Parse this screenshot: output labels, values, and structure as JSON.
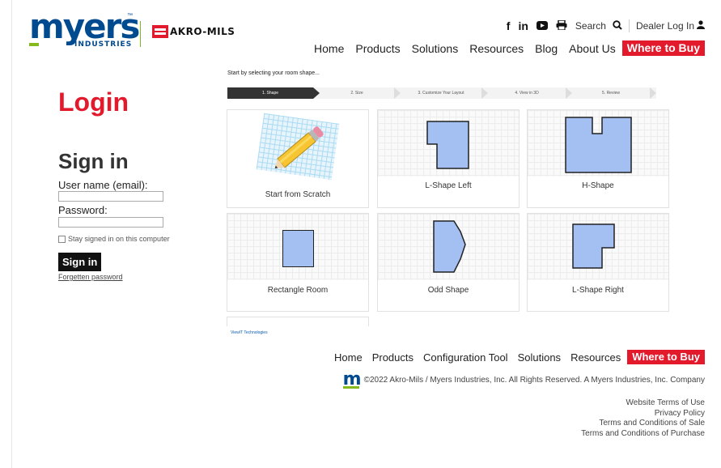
{
  "header": {
    "brand": "myers",
    "brand_sub": "INDUSTRIES",
    "brand_tm": "™",
    "partner_brand": "AKRO-MILS",
    "util": {
      "search_label": "Search",
      "dealer_login_label": "Dealer Log In"
    },
    "nav": [
      "Home",
      "Products",
      "Solutions",
      "Resources",
      "Blog",
      "About Us"
    ],
    "where_to_buy": "Where to Buy"
  },
  "login": {
    "title": "Login",
    "signin_title": "Sign in",
    "username_label": "User name (email):",
    "password_label": "Password:",
    "stay_signed_in": "Stay signed in on this computer",
    "signin_button": "Sign in",
    "forgot_link": "Forgetten password"
  },
  "wizard": {
    "prompt": "Start by selecting your room shape...",
    "steps": [
      "1. Shape",
      "2. Size",
      "3. Customize Your Layout",
      "4. View in 3D",
      "5. Review"
    ],
    "active_step": 0,
    "cards": [
      {
        "label": "Start from Scratch",
        "icon": "pencil-icon"
      },
      {
        "label": "L-Shape Left"
      },
      {
        "label": "H-Shape"
      },
      {
        "label": "Rectangle Room"
      },
      {
        "label": "Odd Shape"
      },
      {
        "label": "L-Shape Right"
      }
    ],
    "credit": "ViewIT Technologies",
    "colors": {
      "shape_fill": "#a4bff2",
      "active_step": "#333333"
    }
  },
  "footer": {
    "nav": [
      "Home",
      "Products",
      "Configuration Tool",
      "Solutions",
      "Resources"
    ],
    "where_to_buy": "Where to Buy",
    "copyright": "©2022 Akro-Mils / Myers Industries, Inc. All Rights Reserved. A Myers Industries, Inc. Company",
    "legal_links": [
      "Website Terms of Use",
      "Privacy Policy",
      "Terms and Conditions of Sale",
      "Terms and Conditions of Purchase"
    ]
  },
  "colors": {
    "brand_blue": "#004a8f",
    "brand_green": "#85b91d",
    "accent_red": "#e3192c"
  }
}
